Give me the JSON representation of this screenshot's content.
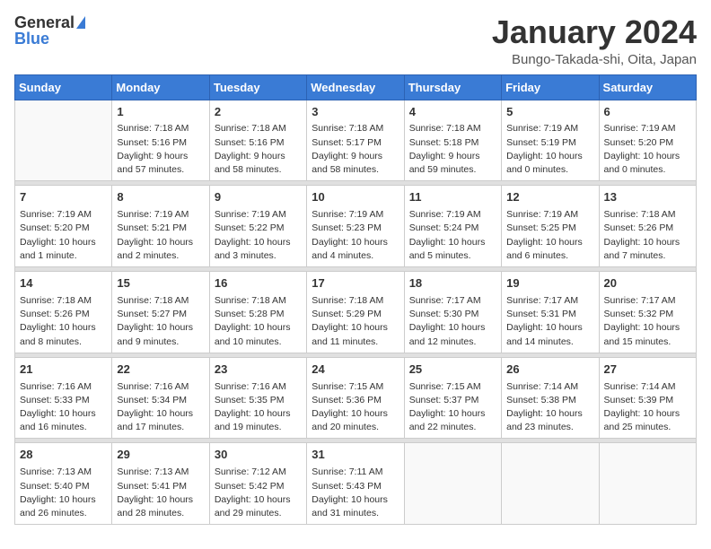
{
  "logo": {
    "general": "General",
    "blue": "Blue"
  },
  "title": "January 2024",
  "location": "Bungo-Takada-shi, Oita, Japan",
  "days_of_week": [
    "Sunday",
    "Monday",
    "Tuesday",
    "Wednesday",
    "Thursday",
    "Friday",
    "Saturday"
  ],
  "weeks": [
    [
      {
        "day": "",
        "info": ""
      },
      {
        "day": "1",
        "info": "Sunrise: 7:18 AM\nSunset: 5:16 PM\nDaylight: 9 hours\nand 57 minutes."
      },
      {
        "day": "2",
        "info": "Sunrise: 7:18 AM\nSunset: 5:16 PM\nDaylight: 9 hours\nand 58 minutes."
      },
      {
        "day": "3",
        "info": "Sunrise: 7:18 AM\nSunset: 5:17 PM\nDaylight: 9 hours\nand 58 minutes."
      },
      {
        "day": "4",
        "info": "Sunrise: 7:18 AM\nSunset: 5:18 PM\nDaylight: 9 hours\nand 59 minutes."
      },
      {
        "day": "5",
        "info": "Sunrise: 7:19 AM\nSunset: 5:19 PM\nDaylight: 10 hours\nand 0 minutes."
      },
      {
        "day": "6",
        "info": "Sunrise: 7:19 AM\nSunset: 5:20 PM\nDaylight: 10 hours\nand 0 minutes."
      }
    ],
    [
      {
        "day": "7",
        "info": "Sunrise: 7:19 AM\nSunset: 5:20 PM\nDaylight: 10 hours\nand 1 minute."
      },
      {
        "day": "8",
        "info": "Sunrise: 7:19 AM\nSunset: 5:21 PM\nDaylight: 10 hours\nand 2 minutes."
      },
      {
        "day": "9",
        "info": "Sunrise: 7:19 AM\nSunset: 5:22 PM\nDaylight: 10 hours\nand 3 minutes."
      },
      {
        "day": "10",
        "info": "Sunrise: 7:19 AM\nSunset: 5:23 PM\nDaylight: 10 hours\nand 4 minutes."
      },
      {
        "day": "11",
        "info": "Sunrise: 7:19 AM\nSunset: 5:24 PM\nDaylight: 10 hours\nand 5 minutes."
      },
      {
        "day": "12",
        "info": "Sunrise: 7:19 AM\nSunset: 5:25 PM\nDaylight: 10 hours\nand 6 minutes."
      },
      {
        "day": "13",
        "info": "Sunrise: 7:18 AM\nSunset: 5:26 PM\nDaylight: 10 hours\nand 7 minutes."
      }
    ],
    [
      {
        "day": "14",
        "info": "Sunrise: 7:18 AM\nSunset: 5:26 PM\nDaylight: 10 hours\nand 8 minutes."
      },
      {
        "day": "15",
        "info": "Sunrise: 7:18 AM\nSunset: 5:27 PM\nDaylight: 10 hours\nand 9 minutes."
      },
      {
        "day": "16",
        "info": "Sunrise: 7:18 AM\nSunset: 5:28 PM\nDaylight: 10 hours\nand 10 minutes."
      },
      {
        "day": "17",
        "info": "Sunrise: 7:18 AM\nSunset: 5:29 PM\nDaylight: 10 hours\nand 11 minutes."
      },
      {
        "day": "18",
        "info": "Sunrise: 7:17 AM\nSunset: 5:30 PM\nDaylight: 10 hours\nand 12 minutes."
      },
      {
        "day": "19",
        "info": "Sunrise: 7:17 AM\nSunset: 5:31 PM\nDaylight: 10 hours\nand 14 minutes."
      },
      {
        "day": "20",
        "info": "Sunrise: 7:17 AM\nSunset: 5:32 PM\nDaylight: 10 hours\nand 15 minutes."
      }
    ],
    [
      {
        "day": "21",
        "info": "Sunrise: 7:16 AM\nSunset: 5:33 PM\nDaylight: 10 hours\nand 16 minutes."
      },
      {
        "day": "22",
        "info": "Sunrise: 7:16 AM\nSunset: 5:34 PM\nDaylight: 10 hours\nand 17 minutes."
      },
      {
        "day": "23",
        "info": "Sunrise: 7:16 AM\nSunset: 5:35 PM\nDaylight: 10 hours\nand 19 minutes."
      },
      {
        "day": "24",
        "info": "Sunrise: 7:15 AM\nSunset: 5:36 PM\nDaylight: 10 hours\nand 20 minutes."
      },
      {
        "day": "25",
        "info": "Sunrise: 7:15 AM\nSunset: 5:37 PM\nDaylight: 10 hours\nand 22 minutes."
      },
      {
        "day": "26",
        "info": "Sunrise: 7:14 AM\nSunset: 5:38 PM\nDaylight: 10 hours\nand 23 minutes."
      },
      {
        "day": "27",
        "info": "Sunrise: 7:14 AM\nSunset: 5:39 PM\nDaylight: 10 hours\nand 25 minutes."
      }
    ],
    [
      {
        "day": "28",
        "info": "Sunrise: 7:13 AM\nSunset: 5:40 PM\nDaylight: 10 hours\nand 26 minutes."
      },
      {
        "day": "29",
        "info": "Sunrise: 7:13 AM\nSunset: 5:41 PM\nDaylight: 10 hours\nand 28 minutes."
      },
      {
        "day": "30",
        "info": "Sunrise: 7:12 AM\nSunset: 5:42 PM\nDaylight: 10 hours\nand 29 minutes."
      },
      {
        "day": "31",
        "info": "Sunrise: 7:11 AM\nSunset: 5:43 PM\nDaylight: 10 hours\nand 31 minutes."
      },
      {
        "day": "",
        "info": ""
      },
      {
        "day": "",
        "info": ""
      },
      {
        "day": "",
        "info": ""
      }
    ]
  ]
}
